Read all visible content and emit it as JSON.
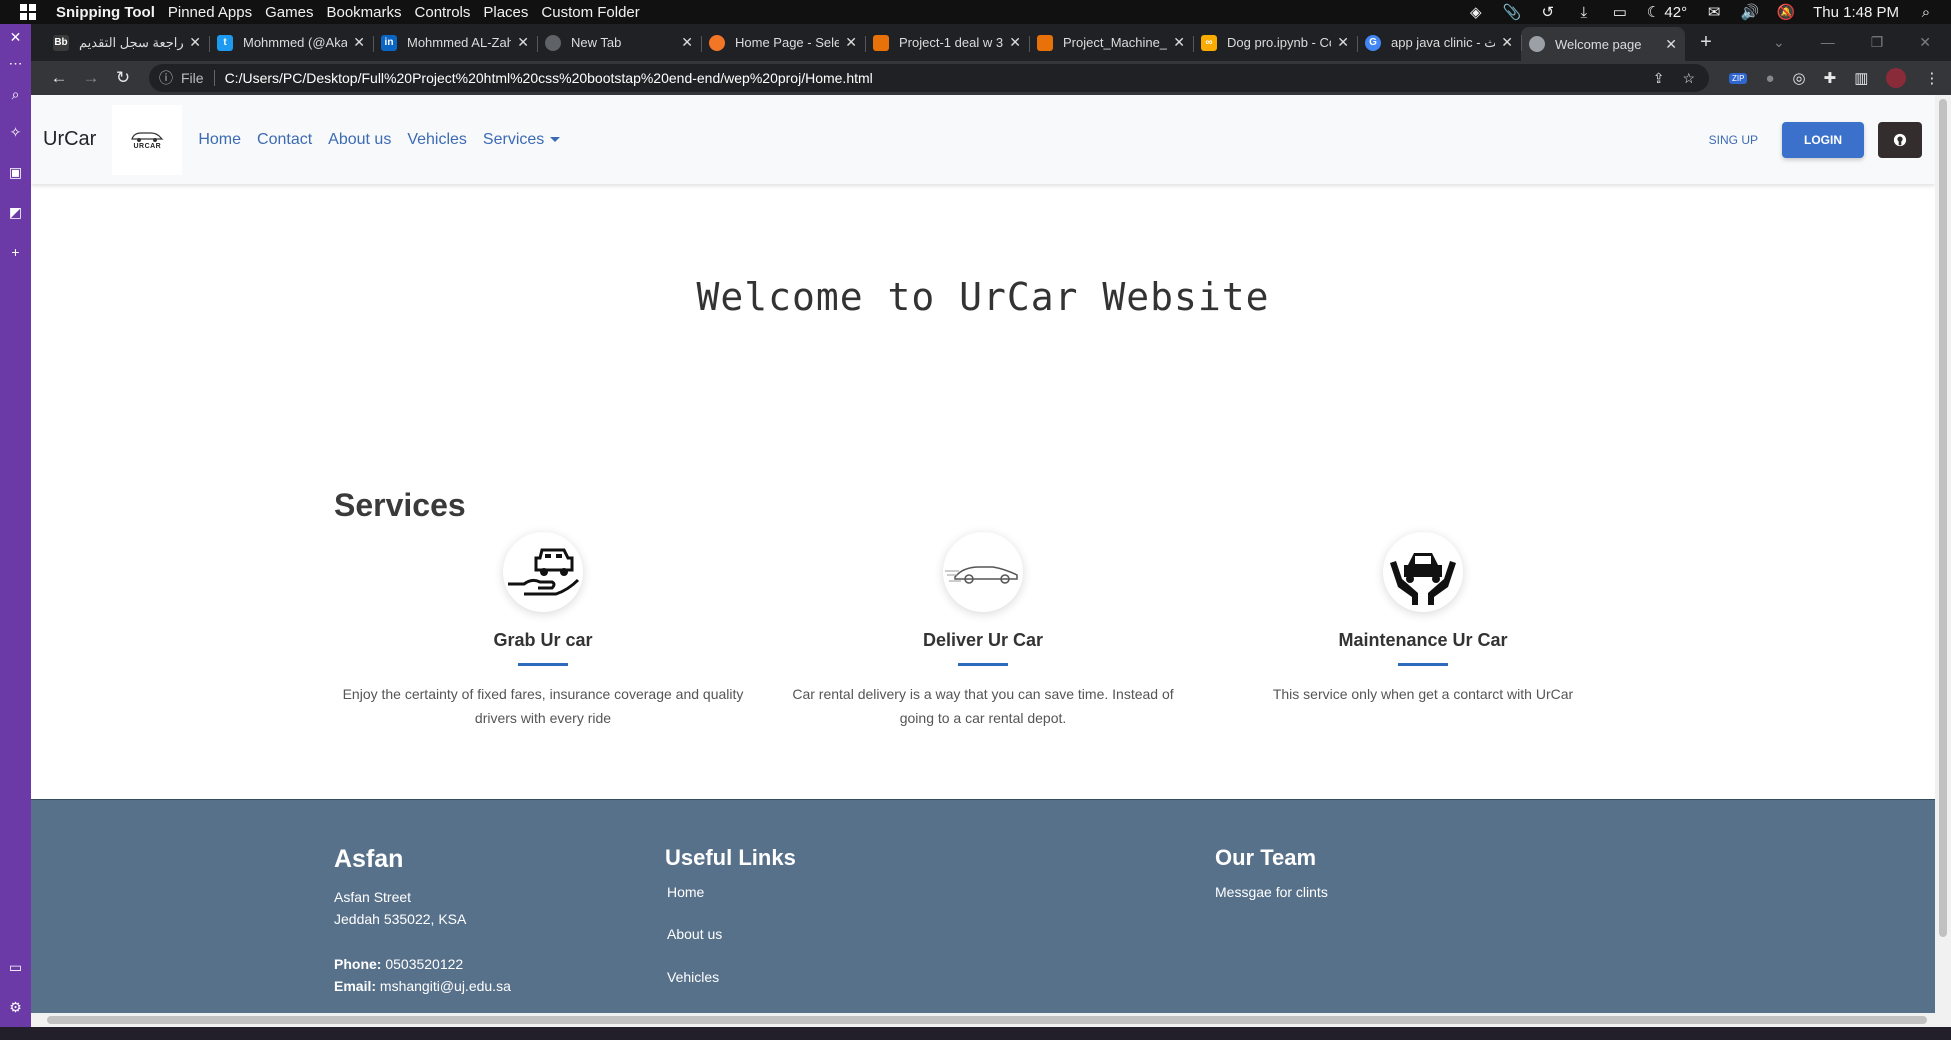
{
  "os": {
    "menu": [
      "Snipping Tool",
      "Pinned Apps",
      "Games",
      "Bookmarks",
      "Controls",
      "Places",
      "Custom Folder"
    ],
    "temperature": "42°",
    "clock": "Thu 1:48 PM"
  },
  "browser": {
    "tabs": [
      {
        "title": "مراجعة سجل التقديم",
        "favicon": "bb-icon",
        "color": "#3b3b3b"
      },
      {
        "title": "Mohmmed (@Akal",
        "favicon": "twitter-icon",
        "color": "#1d9bf0"
      },
      {
        "title": "Mohmmed AL-Zah",
        "favicon": "linkedin-icon",
        "color": "#0a66c2"
      },
      {
        "title": "New Tab",
        "favicon": "chrome-icon",
        "color": "#5f6368"
      },
      {
        "title": "Home Page - Selec",
        "favicon": "jupyter-icon",
        "color": "#f37626"
      },
      {
        "title": "Project-1 deal w 3",
        "favicon": "notebook-icon",
        "color": "#e8710a"
      },
      {
        "title": "Project_Machine_le",
        "favicon": "notebook-icon",
        "color": "#e8710a"
      },
      {
        "title": "Dog pro.ipynb - Co",
        "favicon": "colab-icon",
        "color": "#f9ab00"
      },
      {
        "title": "app java clinic - بحث",
        "favicon": "google-icon",
        "color": "#4285f4"
      },
      {
        "title": "Welcome page",
        "favicon": "globe-icon",
        "color": "#9aa0a6"
      }
    ],
    "file_label": "File",
    "url": "C:/Users/PC/Desktop/Full%20Project%20html%20css%20bootstap%20end-end/wep%20proj/Home.html",
    "zip_badge": "ZIP"
  },
  "site": {
    "brand": "UrCar",
    "logo_text": "URCAR",
    "nav": [
      "Home",
      "Contact",
      "About us",
      "Vehicles"
    ],
    "services_menu": "Services",
    "signup": "SING UP",
    "login": "LOGIN",
    "hero": "Welcome to UrCar Website",
    "services_title": "Services",
    "services": [
      {
        "name": "Grab Ur car",
        "desc": "Enjoy the certainty of fixed fares, insurance coverage and quality drivers with every ride",
        "icon": "hand-car-icon"
      },
      {
        "name": "Deliver Ur Car",
        "desc": "Car rental delivery is a way that you can save time. Instead of going to a car rental depot.",
        "icon": "speed-car-icon"
      },
      {
        "name": "Maintenance Ur Car",
        "desc": "This service only when get a contarct with UrCar",
        "icon": "hands-car-icon"
      }
    ],
    "footer": {
      "title": "Asfan",
      "street": "Asfan Street",
      "city": "Jeddah 535022, KSA",
      "phone_label": "Phone:",
      "phone": "0503520122",
      "email_label": "Email:",
      "email": "mshangiti@uj.edu.sa",
      "links_title": "Useful Links",
      "links": [
        "Home",
        "About us",
        "Vehicles"
      ],
      "team_title": "Our Team",
      "team_text": "Messgae for clints"
    }
  }
}
